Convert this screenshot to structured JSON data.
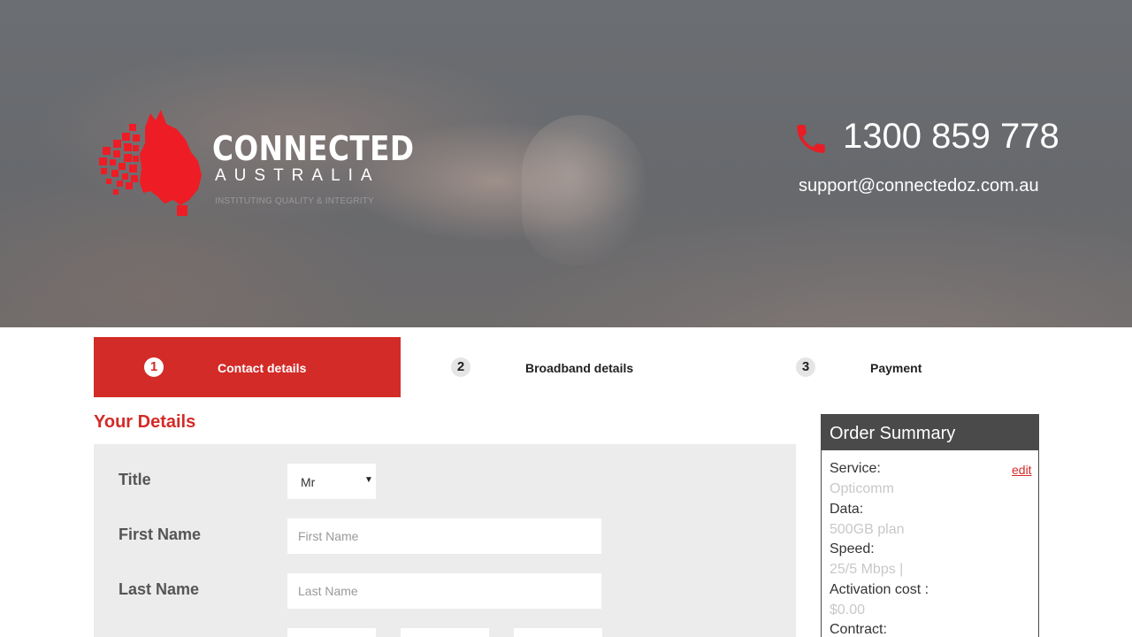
{
  "brand": {
    "name": "CONNECTED",
    "sub": "AUSTRALIA",
    "tagline": "INSTITUTING QUALITY & INTEGRITY",
    "accent": "#d32b27"
  },
  "contact": {
    "phone": "1300 859 778",
    "email": "support@connectedoz.com.au"
  },
  "steps": [
    {
      "num": "1",
      "label": "Contact details",
      "active": true
    },
    {
      "num": "2",
      "label": "Broadband details",
      "active": false
    },
    {
      "num": "3",
      "label": "Payment",
      "active": false
    }
  ],
  "details": {
    "heading": "Your Details",
    "title_label": "Title",
    "title_value": "Mr",
    "first_label": "First Name",
    "first_placeholder": "First Name",
    "last_label": "Last Name",
    "last_placeholder": "Last Name"
  },
  "summary": {
    "heading": "Order Summary",
    "edit": "edit",
    "rows": [
      {
        "label": "Service:",
        "value": "Opticomm"
      },
      {
        "label": "Data:",
        "value": "500GB plan"
      },
      {
        "label": "Speed:",
        "value": "25/5 Mbps |"
      },
      {
        "label": "Activation cost :",
        "value": "$0.00"
      },
      {
        "label": "Contract:",
        "value": ""
      }
    ]
  }
}
